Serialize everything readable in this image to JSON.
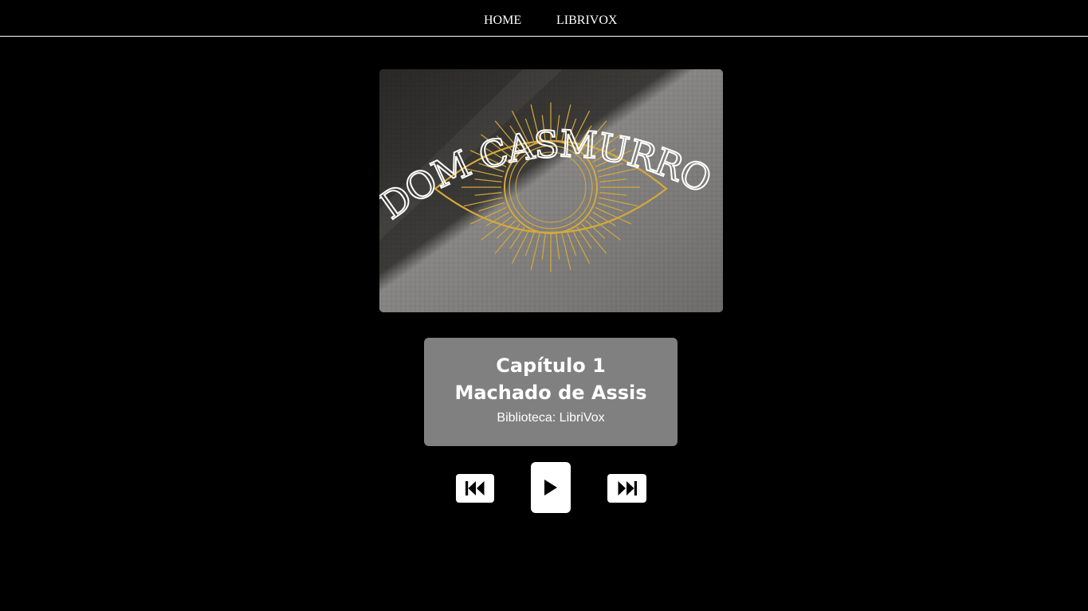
{
  "nav": {
    "home_label": "HOME",
    "librivox_label": "LIBRIVOX"
  },
  "cover": {
    "title_text": "DOM CASMURRO",
    "accent_color": "#d4a93c"
  },
  "track": {
    "chapter": "Capítulo 1",
    "author": "Machado de Assis",
    "library": "Biblioteca: LibriVox"
  },
  "controls": {
    "previous_icon": "skip-previous-icon",
    "play_icon": "play-icon",
    "next_icon": "skip-next-icon"
  },
  "colors": {
    "background": "#000000",
    "card": "#808080",
    "text": "#ffffff"
  }
}
